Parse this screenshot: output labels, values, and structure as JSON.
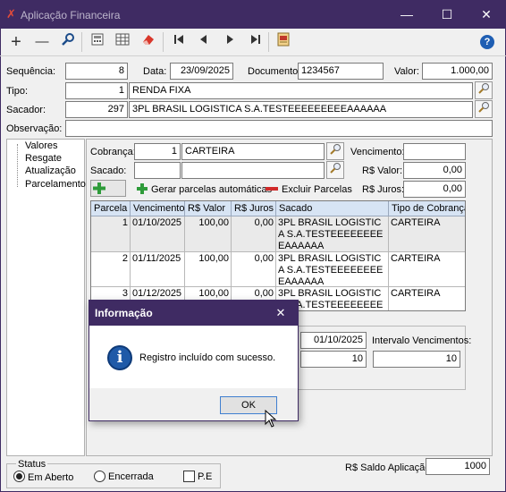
{
  "window": {
    "title": "Aplicação Financeira",
    "minimize": "—",
    "maximize": "☐",
    "close": "✕"
  },
  "toolbar": {
    "add": "+",
    "remove": "—",
    "search": "🔍",
    "calc": "▦",
    "grid": "▤",
    "eraser": "◆",
    "first": "⏮",
    "prev": "◀",
    "next": "▶",
    "last": "⏭",
    "report": "▣",
    "help": "?"
  },
  "header": {
    "sequencia_label": "Sequência:",
    "sequencia": "8",
    "data_label": "Data:",
    "data": "23/09/2025",
    "documento_label": "Documento:",
    "documento": "1234567",
    "valor_label": "Valor:",
    "valor": "1.000,00",
    "tipo_label": "Tipo:",
    "tipo_code": "1",
    "tipo_name": "RENDA FIXA",
    "sacador_label": "Sacador:",
    "sacador_code": "297",
    "sacador_name": "3PL BRASIL LOGISTICA S.A.TESTEEEEEEEEEAAAAAA",
    "observacao_label": "Observação:",
    "observacao": ""
  },
  "tree": [
    "Valores",
    "Resgate",
    "Atualização",
    "Parcelamento"
  ],
  "parcel": {
    "cobranca_label": "Cobrança:",
    "cobranca_code": "1",
    "cobranca_name": "CARTEIRA",
    "vencimento_label": "Vencimento:",
    "vencimento": "",
    "sacado_label": "Sacado:",
    "sacado_code": "",
    "sacado_name": "",
    "rs_valor_label": "R$ Valor:",
    "rs_valor": "0,00",
    "rs_juros_label": "R$ Juros:",
    "rs_juros": "0,00",
    "gerar_label": "Gerar parcelas automáticas",
    "excluir_label": "Excluir Parcelas"
  },
  "table": {
    "columns": [
      "Parcela",
      "Vencimento",
      "R$ Valor",
      "R$ Juros",
      "Sacado",
      "Tipo de Cobrança"
    ],
    "rows": [
      {
        "parcela": "1",
        "vencimento": "01/10/2025",
        "valor": "100,00",
        "juros": "0,00",
        "sacado": "3PL BRASIL LOGISTICA S.A.TESTEEEEEEEEEAAAAAA",
        "tipo": "CARTEIRA"
      },
      {
        "parcela": "2",
        "vencimento": "01/11/2025",
        "valor": "100,00",
        "juros": "0,00",
        "sacado": "3PL BRASIL LOGISTICA S.A.TESTEEEEEEEEEAAAAAA",
        "tipo": "CARTEIRA"
      },
      {
        "parcela": "3",
        "vencimento": "01/12/2025",
        "valor": "100,00",
        "juros": "0,00",
        "sacado": "3PL BRASIL LOGISTICA S.A.TESTEEEEEEEEEAAAAAA",
        "tipo": "CARTEIRA"
      }
    ]
  },
  "gen": {
    "primeiro_venc": "01/10/2025",
    "intervalo_label": "Intervalo Vencimentos:",
    "qtd": "10",
    "intervalo": "10"
  },
  "dialog": {
    "title": "Informação",
    "close": "✕",
    "icon": "i",
    "message": "Registro incluído com sucesso.",
    "ok": "OK"
  },
  "status": {
    "label": "Status",
    "em_aberto": "Em Aberto",
    "encerrada": "Encerrada",
    "pe": "P.E",
    "saldo_label": "R$ Saldo Aplicação:",
    "saldo": "1000"
  },
  "colors": {
    "titlebar": "#3f2b63",
    "header_row": "#d7e4f4",
    "help_blue": "#1e5eb3",
    "info_blue": "#1f5aa8"
  }
}
